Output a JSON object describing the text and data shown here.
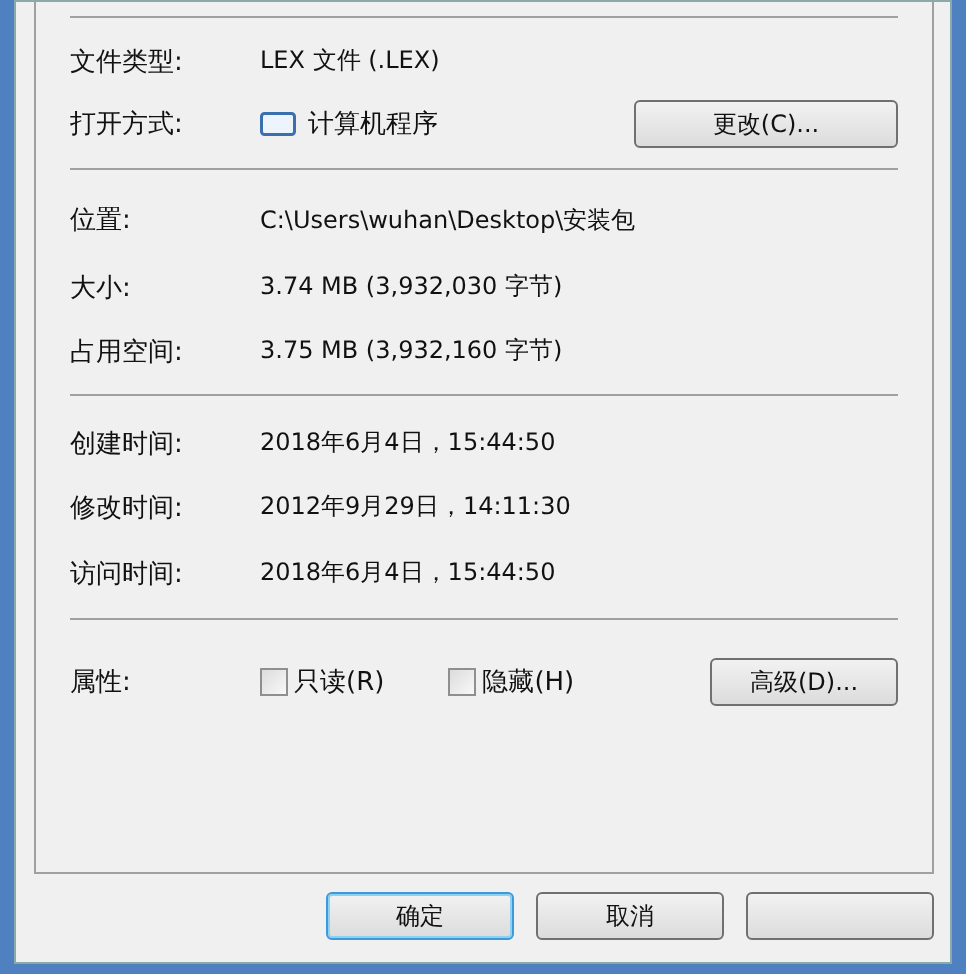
{
  "sections": [
    {
      "rows": [
        {
          "kind": "text",
          "label": "文件类型:",
          "value": "LEX 文件 (.LEX)"
        },
        {
          "kind": "app",
          "label": "打开方式:",
          "value": "计算机程序",
          "button": "更改(C)..."
        }
      ]
    },
    {
      "rows": [
        {
          "kind": "text",
          "label": "位置:",
          "value": "C:\\Users\\wuhan\\Desktop\\安装包"
        },
        {
          "kind": "text",
          "label": "大小:",
          "value": "3.74 MB (3,932,030 字节)"
        },
        {
          "kind": "text",
          "label": "占用空间:",
          "value": "3.75 MB (3,932,160 字节)"
        }
      ]
    },
    {
      "rows": [
        {
          "kind": "text",
          "label": "创建时间:",
          "value": "2018年6月4日，15:44:50"
        },
        {
          "kind": "text",
          "label": "修改时间:",
          "value": "2012年9月29日，14:11:30"
        },
        {
          "kind": "text",
          "label": "访问时间:",
          "value": "2018年6月4日，15:44:50"
        }
      ]
    }
  ],
  "attributes": {
    "label": "属性:",
    "checkboxes": [
      {
        "label": "只读(R)",
        "checked": false
      },
      {
        "label": "隐藏(H)",
        "checked": false
      }
    ],
    "button": "高级(D)..."
  },
  "buttons": [
    {
      "label": "确定",
      "default": true
    },
    {
      "label": "取消",
      "default": false
    }
  ]
}
